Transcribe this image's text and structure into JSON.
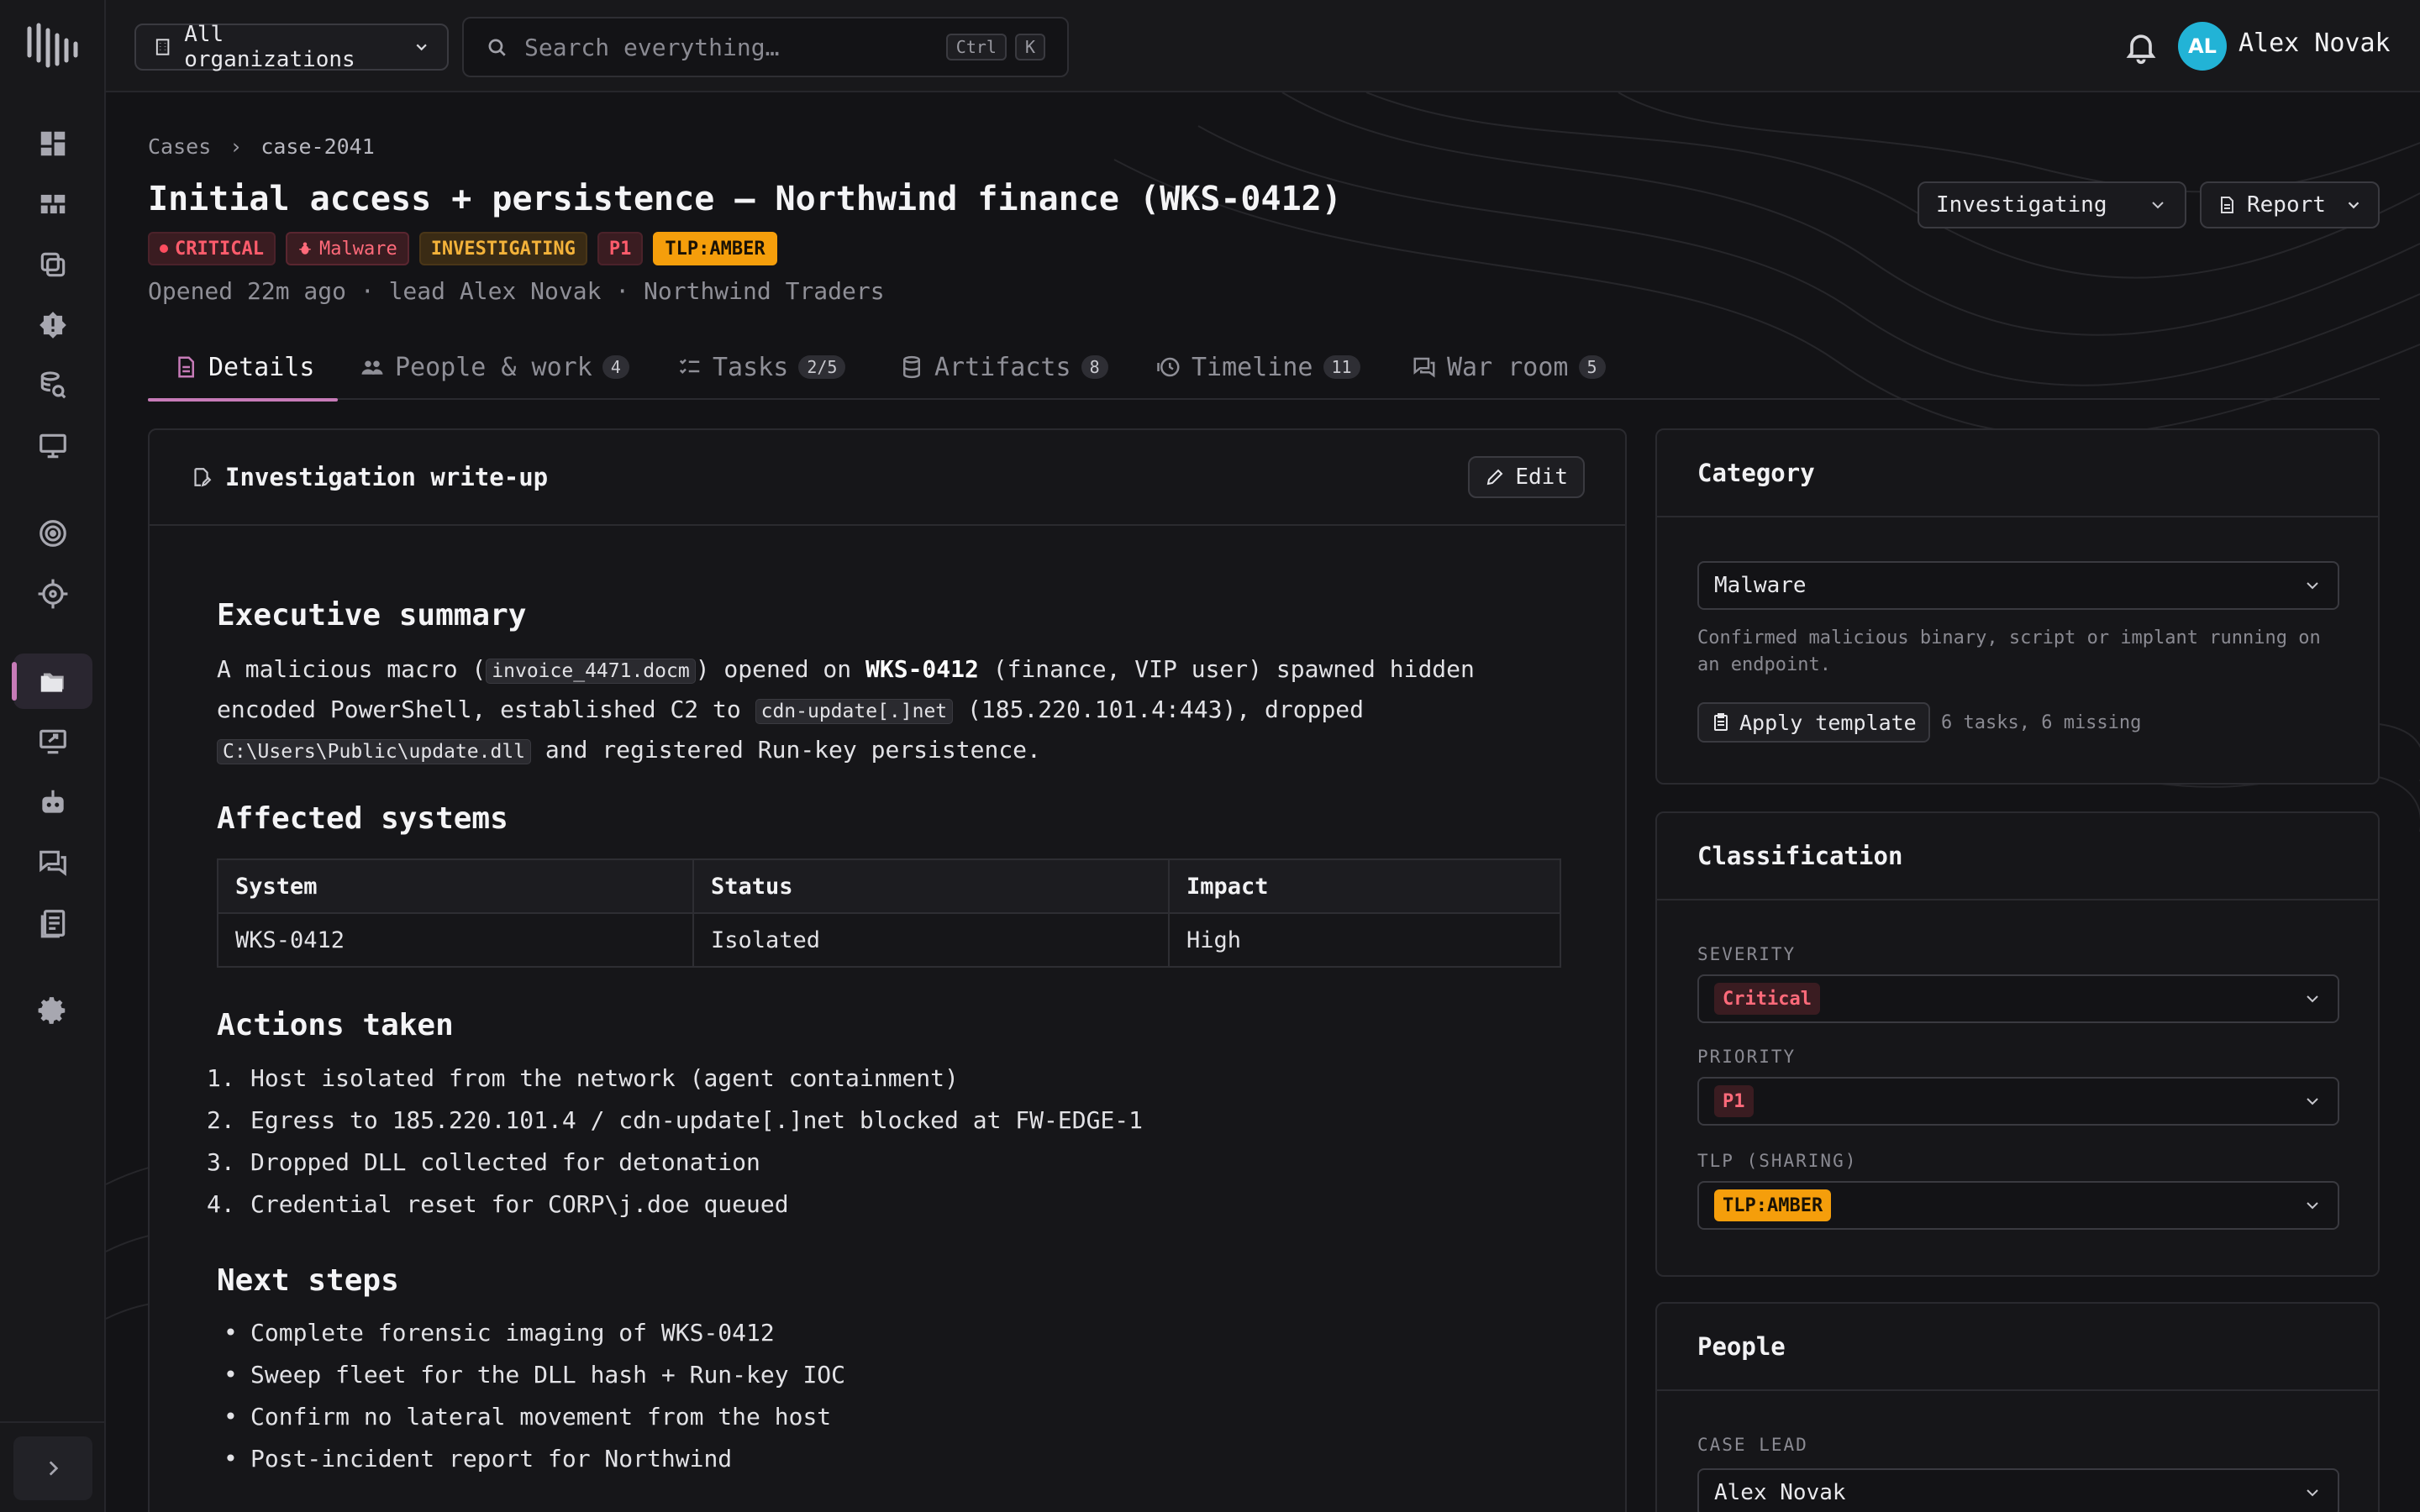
{
  "topbar": {
    "org_select": "All organizations",
    "search_placeholder": "Search everything…",
    "kbd_1": "Ctrl",
    "kbd_2": "K",
    "user": {
      "initials": "AL",
      "name": "Alex Novak"
    }
  },
  "breadcrumb": {
    "root": "Cases",
    "sep": "›",
    "current": "case-2041"
  },
  "case": {
    "title": "Initial access + persistence — Northwind finance (WKS-0412)",
    "badges": {
      "severity": "CRITICAL",
      "category": "Malware",
      "status": "INVESTIGATING",
      "priority": "P1",
      "tlp": "TLP:AMBER"
    },
    "subtitle": "Opened 22m ago · lead Alex Novak · Northwind Traders",
    "status_select": "Investigating",
    "report_label": "Report"
  },
  "tabs": [
    {
      "label": "Details",
      "count": ""
    },
    {
      "label": "People & work",
      "count": "4"
    },
    {
      "label": "Tasks",
      "count": "2/5"
    },
    {
      "label": "Artifacts",
      "count": "8"
    },
    {
      "label": "Timeline",
      "count": "11"
    },
    {
      "label": "War room",
      "count": "5"
    }
  ],
  "writeup": {
    "title": "Investigation write-up",
    "edit_label": "Edit",
    "exec_heading": "Executive summary",
    "exec": {
      "t1": "A malicious macro (",
      "c1": "invoice_4471.docm",
      "t2": ") opened on ",
      "b1": "WKS-0412",
      "t3": " (finance, VIP user) spawned hidden encoded PowerShell, established C2 to ",
      "c2": "cdn-update[.]net",
      "t4": " (185.220.101.4:443), dropped ",
      "c3": "C:\\Users\\Public\\update.dll",
      "t5": " and registered Run-key persistence."
    },
    "affected_heading": "Affected systems",
    "table": {
      "headers": [
        "System",
        "Status",
        "Impact"
      ],
      "rows": [
        [
          "WKS-0412",
          "Isolated",
          "High"
        ]
      ]
    },
    "actions_heading": "Actions taken",
    "actions": [
      "Host isolated from the network (agent containment)",
      "Egress to 185.220.101.4 / cdn-update[.]net blocked at FW-EDGE-1",
      "Dropped DLL collected for detonation",
      "Credential reset for CORP\\j.doe queued"
    ],
    "next_heading": "Next steps",
    "next": [
      "Complete forensic imaging of WKS-0412",
      "Sweep fleet for the DLL hash + Run-key IOC",
      "Confirm no lateral movement from the host",
      "Post-incident report for Northwind"
    ]
  },
  "category_card": {
    "title": "Category",
    "value": "Malware",
    "hint": "Confirmed malicious binary, script or implant running on an endpoint.",
    "apply_label": "Apply template",
    "apply_note": "6 tasks, 6 missing"
  },
  "classification_card": {
    "title": "Classification",
    "severity_label": "SEVERITY",
    "severity_value": "Critical",
    "priority_label": "PRIORITY",
    "priority_value": "P1",
    "tlp_label": "TLP (SHARING)",
    "tlp_value": "TLP:AMBER"
  },
  "people_card": {
    "title": "People",
    "lead_label": "CASE LEAD",
    "lead_value": "Alex Novak"
  }
}
